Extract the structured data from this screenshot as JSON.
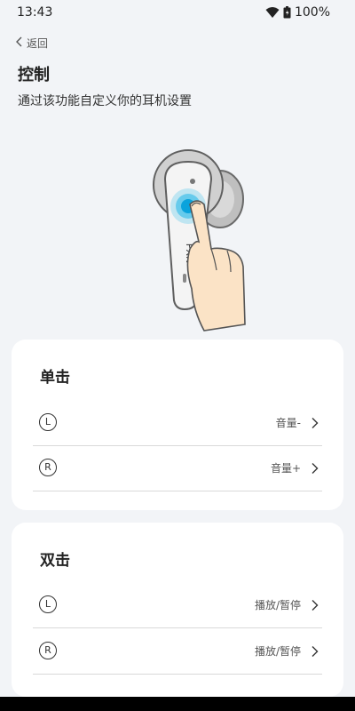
{
  "status": {
    "time": "13:43",
    "battery": "100%"
  },
  "header": {
    "back_label": "返回",
    "title": "控制",
    "subtitle": "通过该功能自定义你的耳机设置"
  },
  "sections": [
    {
      "title": "单击",
      "rows": [
        {
          "side": "L",
          "value": "音量-"
        },
        {
          "side": "R",
          "value": "音量+"
        }
      ]
    },
    {
      "title": "双击",
      "rows": [
        {
          "side": "L",
          "value": "播放/暂停"
        },
        {
          "side": "R",
          "value": "播放/暂停"
        }
      ]
    }
  ],
  "illustration": {
    "earbud_logo": "PXN"
  },
  "colors": {
    "background": "#f2f4f7",
    "card": "#ffffff",
    "touch_accent": "#1fb6e8"
  }
}
